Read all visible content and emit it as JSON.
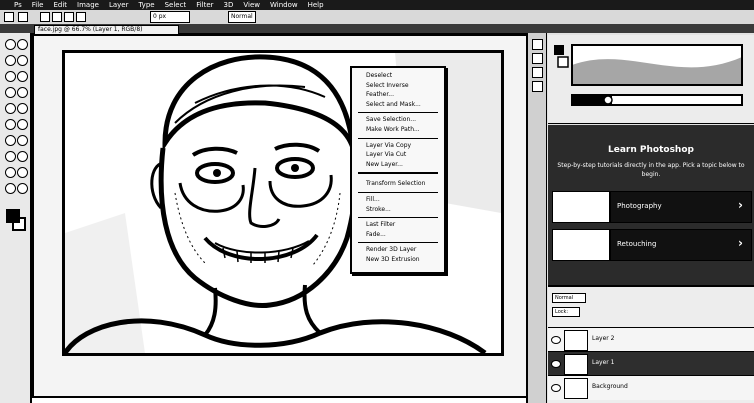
{
  "menubar": {
    "items": [
      "Ps",
      "File",
      "Edit",
      "Image",
      "Layer",
      "Type",
      "Select",
      "Filter",
      "3D",
      "View",
      "Window",
      "Help"
    ]
  },
  "options_bar": {
    "feather_value": "0 px",
    "style_label": "Normal"
  },
  "document": {
    "tab_title": "face.jpg @ 66.7% (Layer 1, RGB/8)"
  },
  "context_menu": {
    "items": [
      {
        "label": "Deselect",
        "group": 1
      },
      {
        "label": "Select Inverse",
        "group": 1
      },
      {
        "label": "Feather...",
        "group": 1
      },
      {
        "label": "Select and Mask...",
        "group": 1
      },
      {
        "label": "Save Selection...",
        "group": 2
      },
      {
        "label": "Make Work Path...",
        "group": 2
      },
      {
        "label": "Layer Via Copy",
        "group": 3
      },
      {
        "label": "Layer Via Cut",
        "group": 3
      },
      {
        "label": "New Layer...",
        "group": 3
      },
      {
        "label": "Transform Selection",
        "group": 4
      },
      {
        "label": "Fill...",
        "group": 5
      },
      {
        "label": "Stroke...",
        "group": 5
      },
      {
        "label": "Last Filter",
        "group": 6
      },
      {
        "label": "Fade...",
        "group": 6
      },
      {
        "label": "Render 3D Layer",
        "group": 7
      },
      {
        "label": "New 3D Extrusion",
        "group": 7
      }
    ]
  },
  "learn_panel": {
    "title": "Learn Photoshop",
    "description": "Step-by-step tutorials directly in the app. Pick a topic below to begin.",
    "tutorials": [
      {
        "label": "Photography"
      },
      {
        "label": "Retouching"
      }
    ]
  },
  "layers_panel": {
    "mode_label": "Normal",
    "lock_label": "Lock:",
    "layers": [
      {
        "name": "Layer 2",
        "selected": false
      },
      {
        "name": "Layer 1",
        "selected": true
      },
      {
        "name": "Background",
        "selected": false
      }
    ]
  },
  "icons": {
    "toolbar": [
      "move-icon",
      "marquee-icon",
      "lasso-icon",
      "quick-select-icon",
      "crop-icon",
      "eyedropper-icon",
      "healing-icon",
      "brush-icon",
      "stamp-icon",
      "history-brush-icon",
      "eraser-icon",
      "gradient-icon",
      "blur-icon",
      "dodge-icon",
      "pen-icon",
      "type-icon",
      "path-select-icon",
      "shape-icon",
      "hand-icon",
      "zoom-icon"
    ]
  },
  "colors": {
    "menubar": "#1a1a1a",
    "learn_panel_bg": "#2b2b2b"
  }
}
